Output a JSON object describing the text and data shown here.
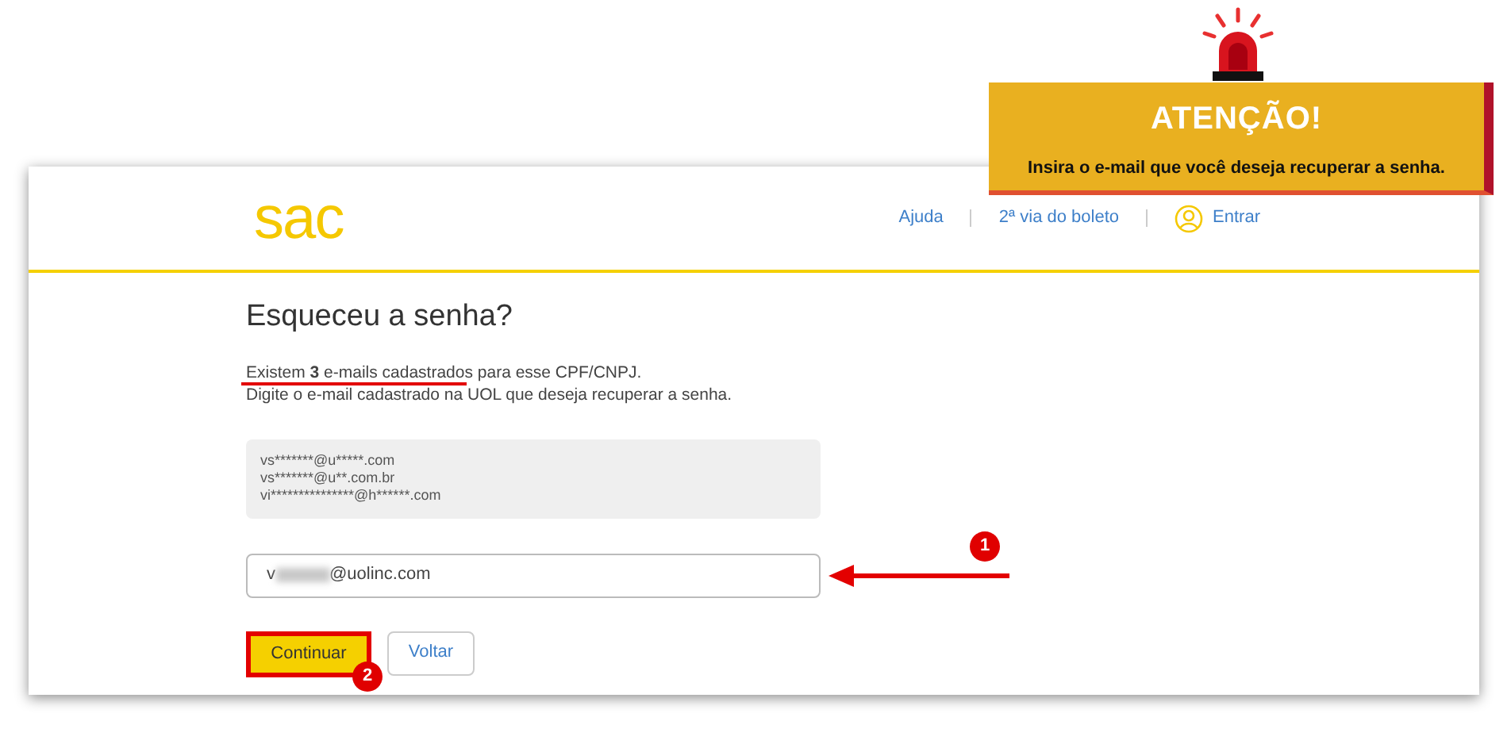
{
  "callout": {
    "title": "ATENÇÃO!",
    "text": "Insira o e-mail que você deseja recuperar a senha."
  },
  "header": {
    "logo": "sac",
    "nav": [
      {
        "label": "Ajuda"
      },
      {
        "label": "2ª via do boleto"
      },
      {
        "label": "Entrar",
        "kind": "user"
      }
    ]
  },
  "form": {
    "title": "Esqueceu a senha?",
    "intro": "Existem **3** e-mails cadastrados para esse CPF/CNPJ.",
    "instruction": "Digite o e-mail cadastrado na UOL que deseja recuperar a senha.",
    "emails": [
      "vs*******@u*****.com",
      "vs*******@u**.com.br",
      "vi***************@h******.com"
    ],
    "field": {
      "value_start": "v",
      "value_end": "@uolinc.com"
    },
    "buttons": [
      {
        "label": "Continuar",
        "kind": "primary"
      },
      {
        "label": "Voltar",
        "kind": "secondary"
      }
    ]
  },
  "annotations": [
    {
      "label": "1"
    },
    {
      "label": "2"
    }
  ]
}
